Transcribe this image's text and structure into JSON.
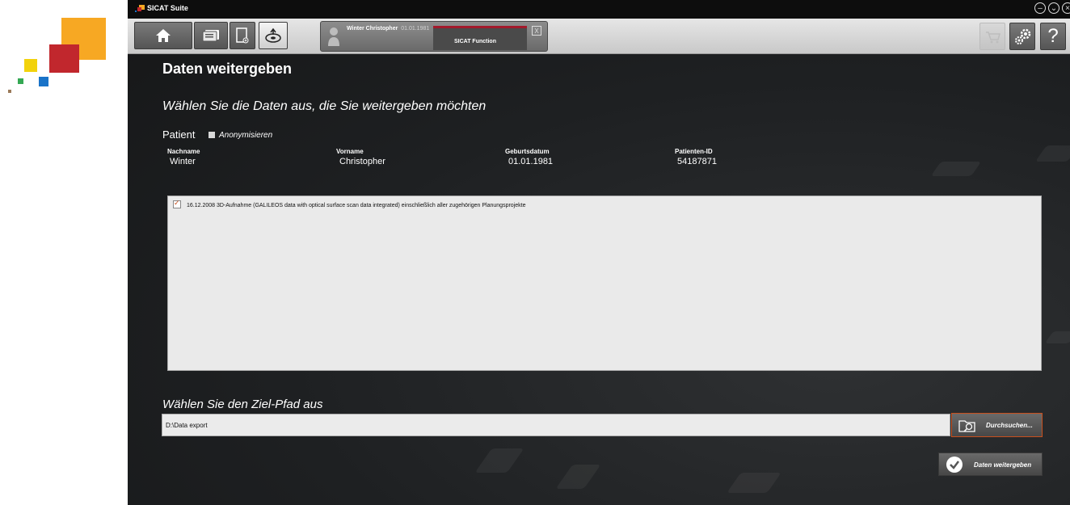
{
  "window": {
    "title": "SICAT Suite"
  },
  "toolbar": {
    "patient_name": "Winter  Christopher",
    "patient_dob": "01.01.1981",
    "function_tab": "SICAT Function",
    "close_label": "X",
    "help_label": "?"
  },
  "page": {
    "title": "Daten weitergeben",
    "select_heading": "Wählen Sie die Daten aus, die Sie weitergeben möchten",
    "patient_label": "Patient",
    "anonymize_label": "Anonymisieren"
  },
  "patient": {
    "columns": [
      "Nachname",
      "Vorname",
      "Geburtsdatum",
      "Patienten-ID"
    ],
    "values": [
      "Winter",
      "Christopher",
      "01.01.1981",
      "54187871"
    ]
  },
  "studies": [
    {
      "checked": true,
      "text": "16.12.2008  3D-Aufnahme (GALILEOS data with optical surface scan data integrated)  einschließlich aller zugehörigen Planungsprojekte"
    }
  ],
  "target": {
    "heading": "Wählen Sie den Ziel-Pfad aus",
    "path_value": "D:\\Data export",
    "browse_label": "Durchsuchen..."
  },
  "actions": {
    "share_label": "Daten weitergeben"
  },
  "colors": {
    "accent": "#c8501e",
    "tab_red": "#a3192b",
    "logo_orange": "#f7a823",
    "logo_red": "#c1272d",
    "logo_yellow": "#f2d20c",
    "logo_green": "#34a853",
    "logo_blue": "#1a73c8"
  }
}
